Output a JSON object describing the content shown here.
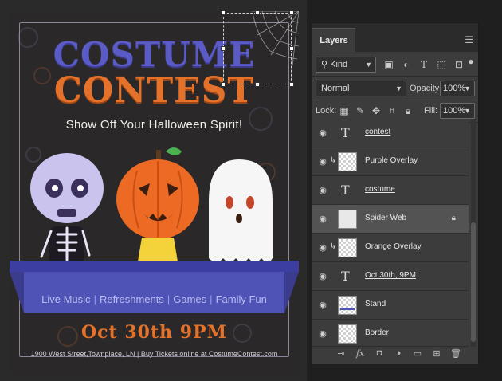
{
  "poster": {
    "title_line1": "COSTUME",
    "title_line2": "CONTEST",
    "tagline": "Show Off Your Halloween Spirit!",
    "activities": [
      "Live Music",
      "Refreshments",
      "Games",
      "Family Fun"
    ],
    "date": "Oct 30th 9PM",
    "footer": "1900 West Street,Townplace, LN  | Buy Tickets online at CostumeContest.com"
  },
  "colors": {
    "title_purple": "#5b5bc7",
    "title_orange": "#e4722a",
    "stand": "#4f53b6",
    "selected_layer": "#535353"
  },
  "layers_panel": {
    "tab": "Layers",
    "menu_icon": "hamburger-icon",
    "kind_filter": "Kind",
    "blend_mode": "Normal",
    "opacity_label": "Opacity:",
    "opacity": "100%",
    "lock_label": "Lock:",
    "fill_label": "Fill:",
    "fill": "100%",
    "layers": [
      {
        "name": "contest",
        "kind": "text",
        "clipped": false,
        "underline": true,
        "selected": false,
        "locked": false
      },
      {
        "name": "Purple Overlay",
        "kind": "pixel",
        "clipped": true,
        "underline": false,
        "selected": false,
        "locked": false
      },
      {
        "name": "costume",
        "kind": "text",
        "clipped": false,
        "underline": true,
        "selected": false,
        "locked": false
      },
      {
        "name": "Spider Web",
        "kind": "pixel",
        "clipped": false,
        "underline": false,
        "selected": true,
        "locked": true
      },
      {
        "name": "Orange Overlay",
        "kind": "pixel",
        "clipped": true,
        "underline": false,
        "selected": false,
        "locked": false
      },
      {
        "name": "Oct 30th, 9PM",
        "kind": "text",
        "clipped": false,
        "underline": true,
        "selected": false,
        "locked": false
      },
      {
        "name": "Stand",
        "kind": "pixel",
        "clipped": false,
        "underline": false,
        "selected": false,
        "locked": false
      },
      {
        "name": "Border",
        "kind": "pixel",
        "clipped": false,
        "underline": false,
        "selected": false,
        "locked": false
      }
    ],
    "footer_icons": [
      "link-icon",
      "fx-icon",
      "mask-icon",
      "adjustment-icon",
      "folder-icon",
      "new-layer-icon",
      "trash-icon"
    ]
  }
}
